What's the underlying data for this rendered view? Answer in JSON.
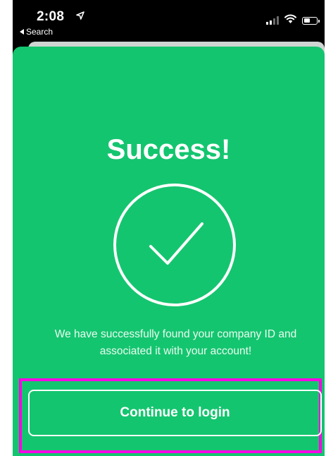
{
  "status_bar": {
    "time": "2:08",
    "back_label": "Search"
  },
  "success": {
    "title": "Success!",
    "message_line1": "We have successfully found your company ID and",
    "message_line2": "associated it with your account!"
  },
  "actions": {
    "continue_label": "Continue to login"
  },
  "colors": {
    "sheet_background": "#14c56f",
    "highlight": "#ff00e6",
    "text": "#ffffff"
  },
  "icons": {
    "status_location": "location-arrow-icon",
    "status_signal": "cellular-signal-icon",
    "status_wifi": "wifi-icon",
    "status_battery": "battery-icon",
    "success": "checkmark-circle-icon"
  }
}
